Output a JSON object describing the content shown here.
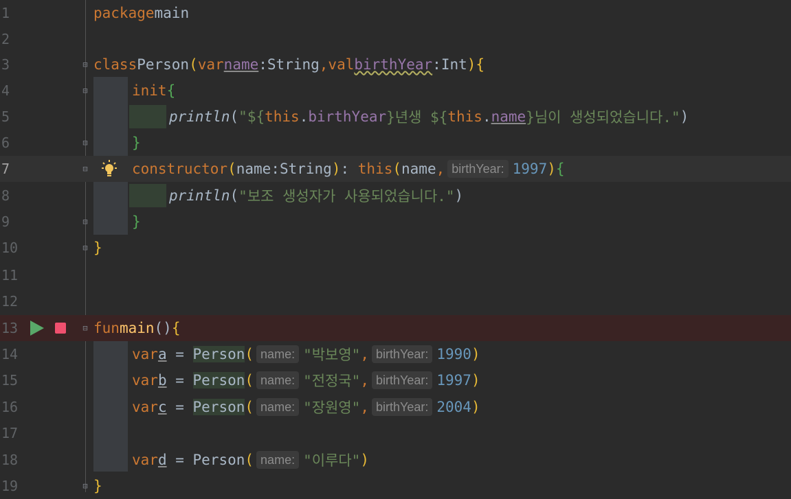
{
  "editor": {
    "line_numbers": [
      "1",
      "2",
      "3",
      "4",
      "5",
      "6",
      "7",
      "8",
      "9",
      "10",
      "11",
      "12",
      "13",
      "14",
      "15",
      "16",
      "17",
      "18",
      "19"
    ],
    "active_line": "7",
    "hints": {
      "birthYear": "birthYear:",
      "name": "name:"
    },
    "tokens": {
      "package": "package",
      "main_pkg": "main",
      "class": "class",
      "Person": "Person",
      "var": "var",
      "val": "val",
      "name": "name",
      "String": "String",
      "birthYear": "birthYear",
      "Int": "Int",
      "init": "init",
      "println": "println",
      "this": "this",
      "constructor": "constructor",
      "fun": "fun",
      "main": "main",
      "a": "a",
      "b": "b",
      "c": "c",
      "d": "d"
    },
    "strings": {
      "str_birth_open": "\"${",
      "str_after_birth": "}년생 ${",
      "str_after_name": "}님이 생성되었습니다.\"",
      "str_aux": "\"보조 생성자가 사용되었습니다.\"",
      "a_name": "\"박보영\"",
      "b_name": "\"전정국\"",
      "c_name": "\"장원영\"",
      "d_name": "\"이루다\""
    },
    "numbers": {
      "ctor_year": "1997",
      "a_year": "1990",
      "b_year": "1997",
      "c_year": "2004"
    }
  },
  "colors": {
    "keyword": "#cc7832",
    "function": "#ffc66d",
    "string": "#6a8759",
    "number": "#6897bb",
    "property": "#9876aa",
    "background": "#2b2b2b"
  },
  "icons": {
    "run": "run-icon",
    "breakpoint": "stop-icon",
    "intention": "lightbulb-icon"
  }
}
